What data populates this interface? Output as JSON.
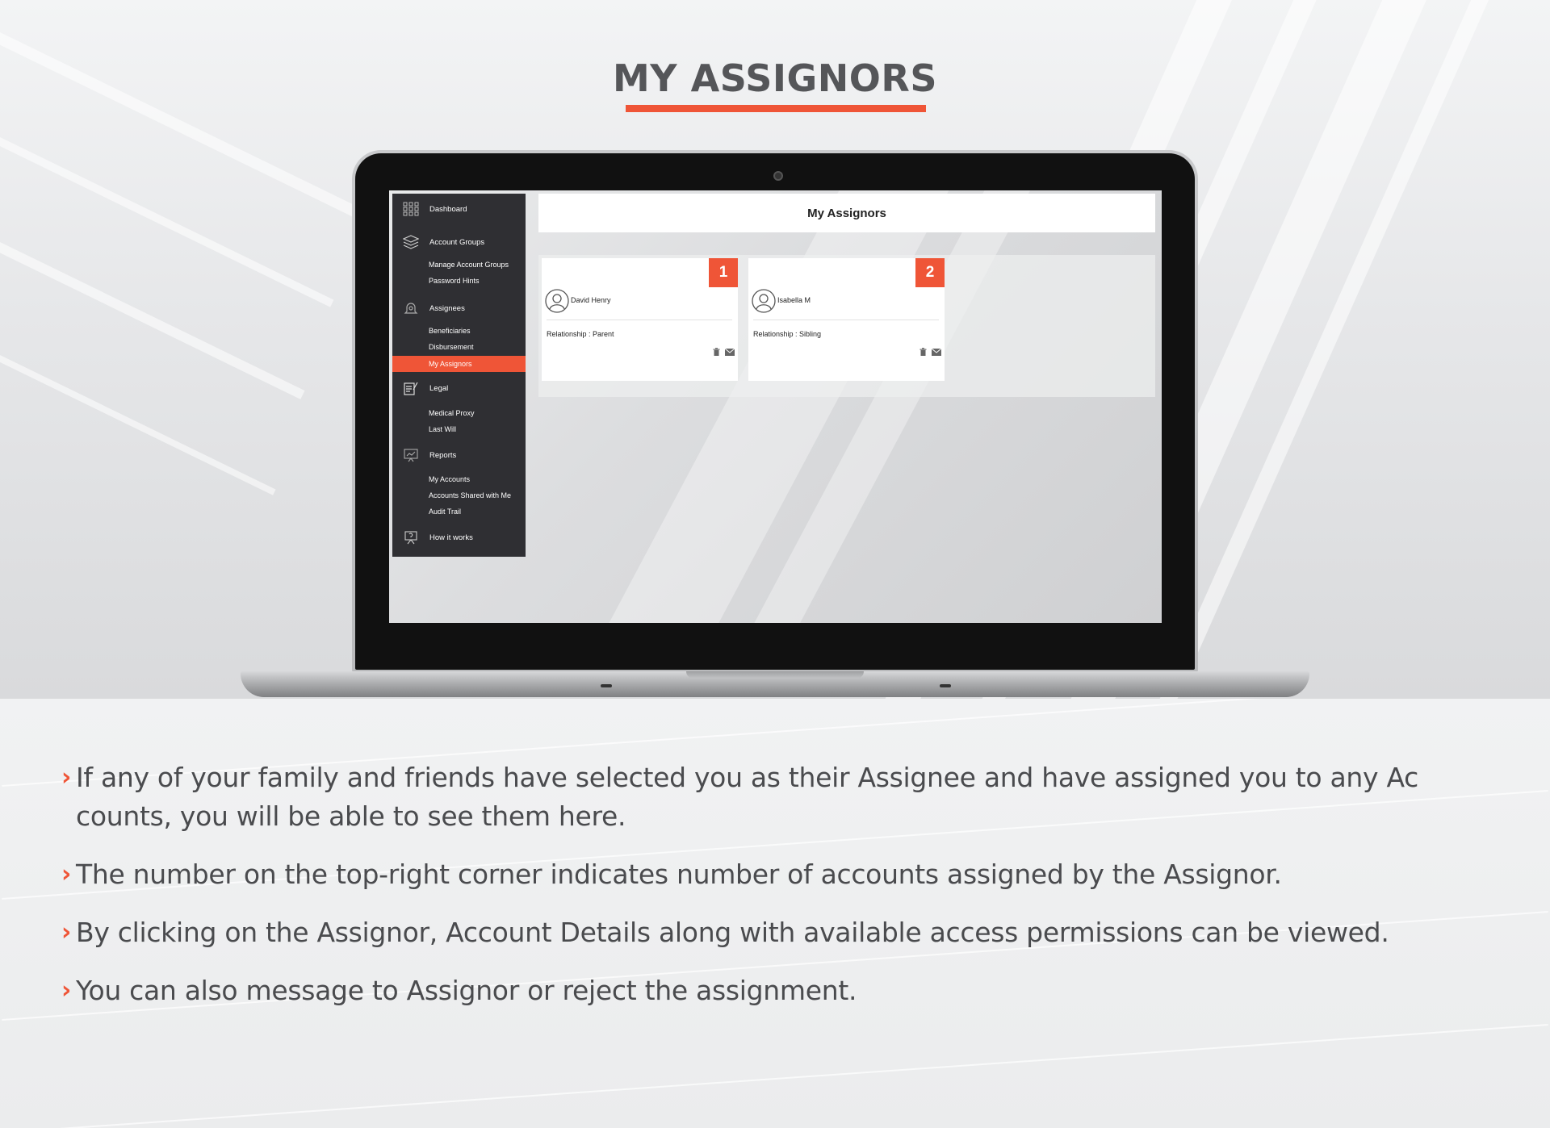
{
  "heading": "MY ASSIGNORS",
  "colors": {
    "accent": "#ef5537",
    "sidebar": "#2f2f33"
  },
  "sidebar": {
    "sections": [
      {
        "label": "Dashboard",
        "icon": "grid-icon",
        "items": []
      },
      {
        "label": "Account Groups",
        "icon": "layers-icon",
        "items": [
          "Manage Account Groups",
          "Password Hints"
        ]
      },
      {
        "label": "Assignees",
        "icon": "bell-icon",
        "items": [
          "Beneficiaries",
          "Disbursement",
          "My Assignors"
        ]
      },
      {
        "label": "Legal",
        "icon": "edit-document-icon",
        "items": [
          "Medical Proxy",
          "Last Will"
        ]
      },
      {
        "label": "Reports",
        "icon": "presentation-icon",
        "items": [
          "My Accounts",
          "Accounts Shared with Me",
          "Audit Trail"
        ]
      },
      {
        "label": "How it works",
        "icon": "help-board-icon",
        "items": []
      }
    ],
    "active_item": "My Assignors"
  },
  "content": {
    "title": "My Assignors",
    "cards": [
      {
        "count": "1",
        "name": "David Henry",
        "relationship": "Relationship : Parent"
      },
      {
        "count": "2",
        "name": "Isabella M",
        "relationship": "Relationship : Sibling"
      }
    ]
  },
  "points": [
    "If any of your family and friends have selected you as their Assignee and have assigned you to any Ac counts, you will be able to see them here.",
    "The number on the top-right corner indicates number of accounts assigned by the Assignor.",
    "By clicking on the Assignor, Account Details along with available access permissions can be viewed.",
    "You can also message to Assignor or reject the assignment."
  ],
  "bullet_glyph": "›"
}
